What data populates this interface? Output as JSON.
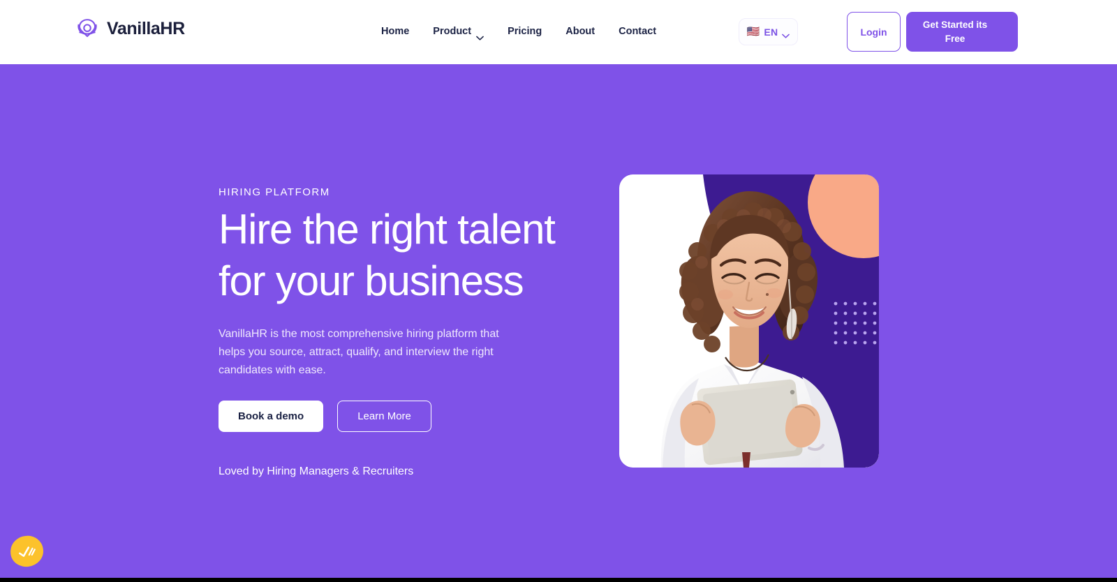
{
  "header": {
    "brand": {
      "name": "VanillaHR",
      "logo_icon": "clover-flower-logo",
      "color": "#7f52e8"
    },
    "nav": [
      {
        "label": "Home",
        "has_dropdown": false
      },
      {
        "label": "Product",
        "has_dropdown": true,
        "icon": "chevron-down-icon"
      },
      {
        "label": "Pricing",
        "has_dropdown": false
      },
      {
        "label": "About",
        "has_dropdown": false
      },
      {
        "label": "Contact",
        "has_dropdown": false
      }
    ],
    "language": {
      "flag_icon": "us-flag-icon",
      "flag": "🇺🇸",
      "code": "EN",
      "chevron_icon": "chevron-down-icon"
    },
    "login_label": "Login",
    "get_started_label": "Get Started its Free"
  },
  "hero": {
    "eyebrow": "HIRING PLATFORM",
    "headline": "Hire the right talent\nfor your business",
    "subcopy": "VanillaHR is the most comprehensive hiring platform that helps you source, attract, qualify, and interview the right candidates with ease.",
    "primary_cta": "Book a demo",
    "secondary_cta": "Learn More",
    "social_proof": "Loved by Hiring Managers & Recruiters",
    "background_color": "#7f52e8",
    "image": {
      "alt": "Smiling woman with curly hair holding a tablet",
      "card_background": "#ffffff",
      "blob_color": "#3d1b91",
      "circle_color": "#f9a987",
      "dot_grid_color": "#b9a4ef",
      "dot_grid_rows": 5,
      "dot_grid_cols": 5
    }
  },
  "floating_badge": {
    "icon": "double-check-icon",
    "background_color": "#fcc22b",
    "label": "accessibility-widget"
  }
}
